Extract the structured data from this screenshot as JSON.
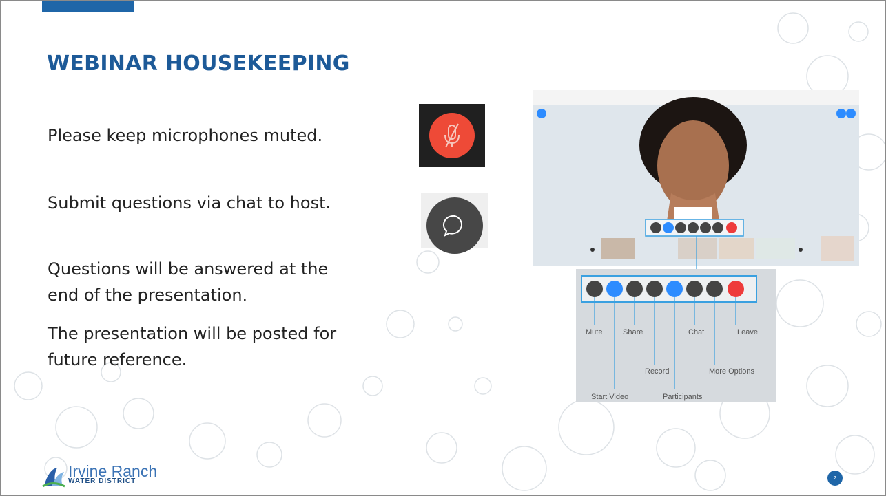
{
  "slide": {
    "title": "WEBINAR HOUSEKEEPING",
    "lines": [
      "Please keep microphones muted.",
      "Submit questions via chat to host.",
      "Questions will be answered at the",
      "end of the presentation.",
      "The presentation will be posted for",
      "future reference."
    ],
    "page_number": "2",
    "accent_color": "#1f66a8",
    "title_color": "#1d5a98"
  },
  "icons": {
    "mute_icon": "microphone-muted-icon",
    "chat_icon": "chat-bubble-icon",
    "mute_color": "#ee4a37"
  },
  "zoom_toolbar": {
    "labels": {
      "mute": "Mute",
      "share": "Share",
      "chat": "Chat",
      "leave": "Leave",
      "record": "Record",
      "more_options": "More Options",
      "start_video": "Start Video",
      "participants": "Participants"
    }
  },
  "logo": {
    "name": "Irvine Ranch",
    "subtitle": "WATER DISTRICT"
  }
}
